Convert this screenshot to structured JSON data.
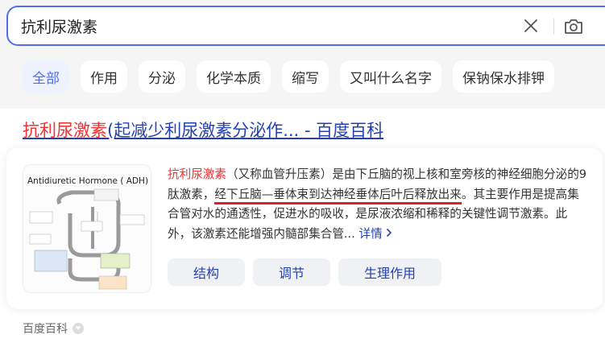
{
  "search": {
    "query": "抗利尿激素"
  },
  "tabs": [
    {
      "label": "全部",
      "active": true
    },
    {
      "label": "作用",
      "active": false
    },
    {
      "label": "分泌",
      "active": false
    },
    {
      "label": "化学本质",
      "active": false
    },
    {
      "label": "缩写",
      "active": false
    },
    {
      "label": "又叫什么名字",
      "active": false
    },
    {
      "label": "保钠保水排钾",
      "active": false
    }
  ],
  "result": {
    "title_highlight": "抗利尿激素",
    "title_rest": "(起减少利尿激素分泌作... - 百度百科",
    "thumbnail_title": "Antidiuretic Hormone ( ADH)",
    "desc": {
      "highlight": "抗利尿激素",
      "part1": "（又称血管升压素）是由下丘脑的视上核和室旁核的神经细胞分泌的9肽激素，",
      "marked": "经下丘脑—垂体束到达神经垂体后叶后释放出来",
      "part2": "。其主要作用是提高集合管对水的通透性，促进水的吸收，是尿液浓缩和稀释的关键性调节激素。此外，该激素还能增强内髓部集合管...",
      "more": "详情"
    },
    "sub_buttons": [
      "结构",
      "调节",
      "生理作用"
    ],
    "source": "百度百科"
  },
  "colors": {
    "accent": "#4e6ef2",
    "link": "#2440b3",
    "highlight": "#f73131",
    "underline_mark": "#e02020"
  },
  "icons": {
    "clear": "close-icon",
    "camera": "camera-icon",
    "more": "chevron-right-icon",
    "source": "chevron-down-icon"
  }
}
